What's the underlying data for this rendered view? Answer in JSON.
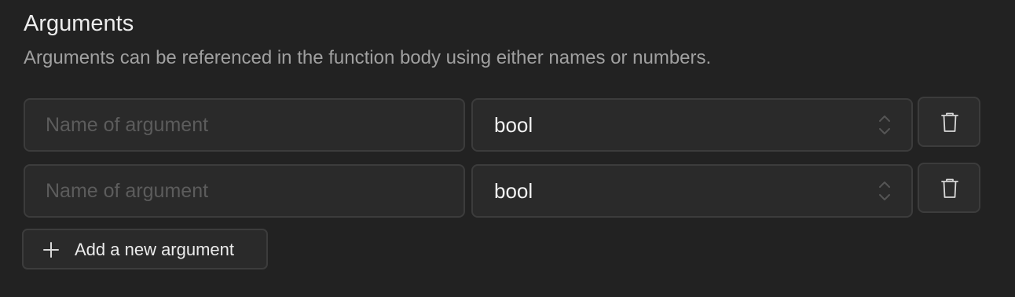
{
  "section": {
    "title": "Arguments",
    "description": "Arguments can be referenced in the function body using either names or numbers."
  },
  "arguments": [
    {
      "name_value": "",
      "name_placeholder": "Name of argument",
      "type": "bool"
    },
    {
      "name_value": "",
      "name_placeholder": "Name of argument",
      "type": "bool"
    }
  ],
  "icons": {
    "select": "chevron-up-down-icon",
    "delete": "trash-icon",
    "add": "plus-icon"
  },
  "add_button": {
    "label": "Add a new argument"
  },
  "colors": {
    "background": "#222222",
    "field_background": "#2a2a2a",
    "border": "#3c3c3c",
    "text_primary": "#ededed",
    "text_secondary": "#a0a0a0",
    "placeholder": "#5c5c5c"
  }
}
